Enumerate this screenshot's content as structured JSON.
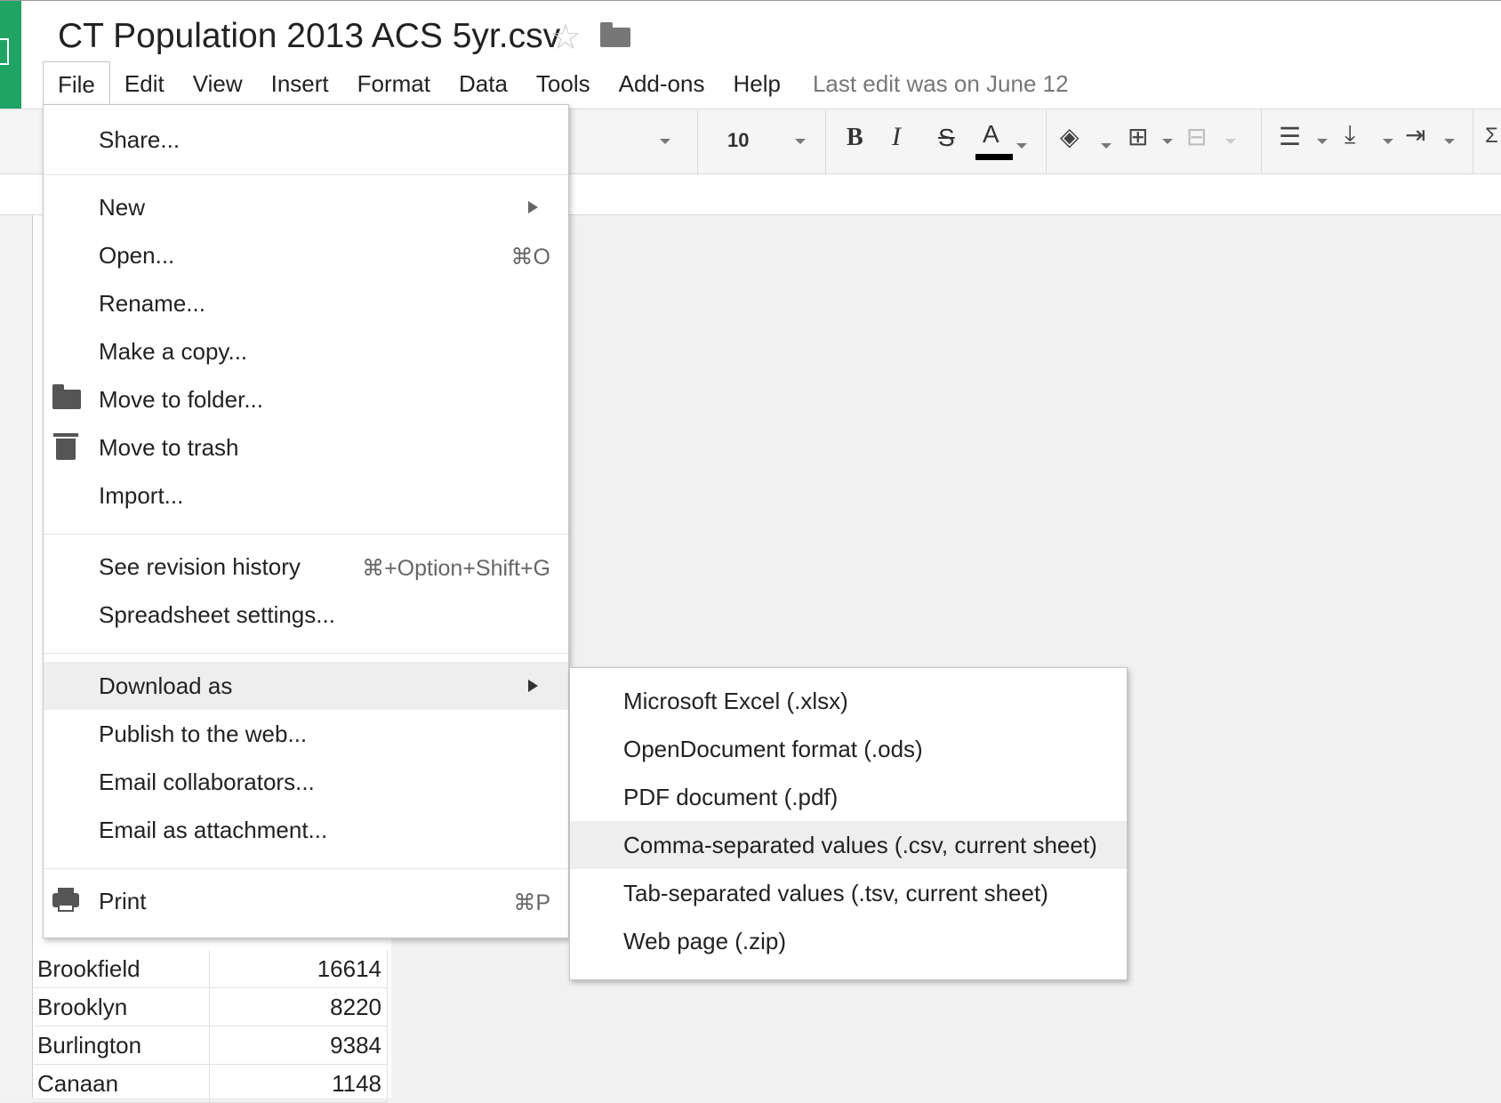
{
  "document": {
    "title": "CT Population 2013 ACS 5yr.csv",
    "star_icon": "star-icon",
    "folder_icon": "folder-icon"
  },
  "menubar": {
    "items": [
      "File",
      "Edit",
      "View",
      "Insert",
      "Format",
      "Data",
      "Tools",
      "Add-ons",
      "Help"
    ],
    "last_edit": "Last edit was on June 12"
  },
  "toolbar": {
    "font_fragment": "l",
    "font_size": "10",
    "bold": "B",
    "italic": "I",
    "strike": "S",
    "text_color": "A",
    "text_color_value": "#000000"
  },
  "grid": {
    "rows": [
      {
        "name": "Brookfield",
        "value": "16614"
      },
      {
        "name": "Brooklyn",
        "value": "8220"
      },
      {
        "name": "Burlington",
        "value": "9384"
      },
      {
        "name": "Canaan",
        "value": "1148"
      }
    ]
  },
  "file_menu": {
    "share": "Share...",
    "new": "New",
    "open": "Open...",
    "open_shortcut": "⌘O",
    "rename": "Rename...",
    "make_copy": "Make a copy...",
    "move_to_folder": "Move to folder...",
    "move_to_trash": "Move to trash",
    "import": "Import...",
    "revision_history": "See revision history",
    "revision_shortcut": "⌘+Option+Shift+G",
    "spreadsheet_settings": "Spreadsheet settings...",
    "download_as": "Download as",
    "publish": "Publish to the web...",
    "email_collaborators": "Email collaborators...",
    "email_attachment": "Email as attachment...",
    "print": "Print",
    "print_shortcut": "⌘P"
  },
  "download_menu": {
    "items": [
      "Microsoft Excel (.xlsx)",
      "OpenDocument format (.ods)",
      "PDF document (.pdf)",
      "Comma-separated values (.csv, current sheet)",
      "Tab-separated values (.tsv, current sheet)",
      "Web page (.zip)"
    ],
    "highlighted_index": 3
  },
  "colors": {
    "logo_green": "#1fa463",
    "highlight": "#eeeeee",
    "menu_border": "#c6c6c6"
  }
}
